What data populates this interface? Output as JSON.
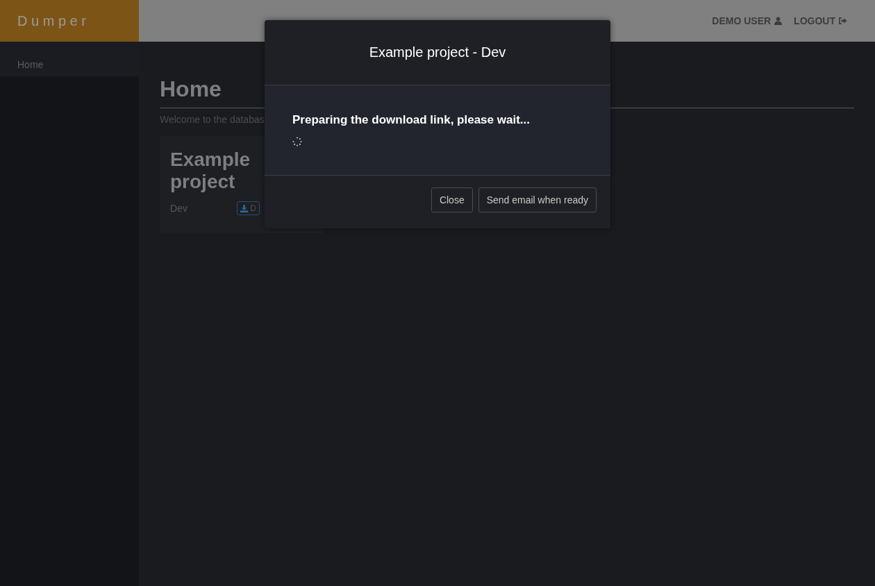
{
  "brand": "D u m p e r",
  "header": {
    "user": "DEMO USER",
    "logout": "LOGOUT"
  },
  "sidebar": {
    "items": [
      {
        "label": "Home",
        "selected": true
      }
    ]
  },
  "page": {
    "title": "Home",
    "intro": "Welcome to the databas",
    "card": {
      "title": "Example project",
      "environment": "Dev",
      "download_button": "D"
    }
  },
  "modal": {
    "title": "Example project - Dev",
    "message": "Preparing the download link, please wait...",
    "buttons": [
      "Close",
      "Send email when ready"
    ]
  }
}
